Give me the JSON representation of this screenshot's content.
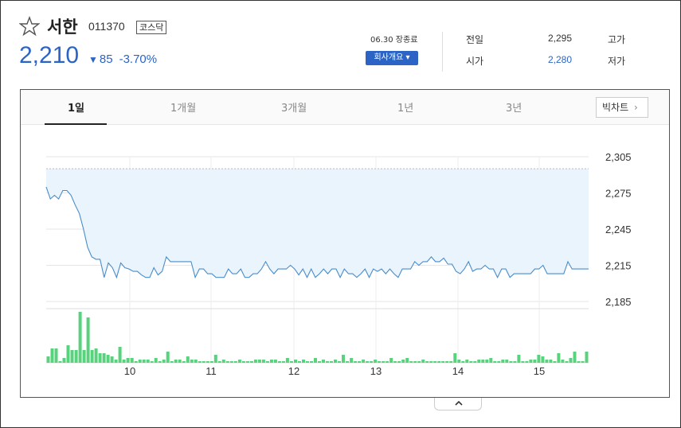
{
  "stock": {
    "name": "서한",
    "code": "011370",
    "market": "코스닥",
    "price": "2,210",
    "change": "85",
    "change_pct": "-3.70%",
    "close_info": "06.30 장종료",
    "company_button": "회사개요"
  },
  "stats": {
    "prev_label": "전일",
    "prev_value": "2,295",
    "high_label": "고가",
    "open_label": "시가",
    "open_value": "2,280",
    "low_label": "저가"
  },
  "tabs": [
    "1일",
    "1개월",
    "3개월",
    "1년",
    "3년"
  ],
  "active_tab": "1일",
  "big_chart_label": "빅차트",
  "colors": {
    "price_line": "#4a8cc9",
    "area_fill": "#eaf4fd",
    "volume_bar": "#59d27d",
    "down": "#2c64c6"
  },
  "chart_data": {
    "type": "line",
    "y_ticks": [
      "2,305",
      "2,275",
      "2,245",
      "2,215",
      "2,185"
    ],
    "ylim": [
      2185,
      2305
    ],
    "x_ticks": [
      "10",
      "11",
      "12",
      "13",
      "14",
      "15"
    ],
    "prev_close": 2295,
    "price_series": [
      2280,
      2270,
      2273,
      2270,
      2277,
      2277,
      2273,
      2265,
      2258,
      2245,
      2230,
      2222,
      2220,
      2220,
      2205,
      2217,
      2213,
      2205,
      2217,
      2213,
      2212,
      2210,
      2210,
      2207,
      2205,
      2205,
      2213,
      2207,
      2210,
      2222,
      2218,
      2218,
      2218,
      2218,
      2218,
      2218,
      2205,
      2212,
      2212,
      2208,
      2208,
      2205,
      2205,
      2205,
      2212,
      2208,
      2208,
      2212,
      2205,
      2205,
      2208,
      2208,
      2212,
      2218,
      2212,
      2208,
      2212,
      2212,
      2212,
      2215,
      2212,
      2207,
      2212,
      2205,
      2212,
      2205,
      2208,
      2212,
      2208,
      2212,
      2212,
      2205,
      2212,
      2208,
      2208,
      2205,
      2208,
      2212,
      2205,
      2212,
      2210,
      2212,
      2208,
      2212,
      2208,
      2205,
      2212,
      2212,
      2212,
      2218,
      2215,
      2218,
      2218,
      2222,
      2218,
      2218,
      2221,
      2216,
      2216,
      2210,
      2208,
      2212,
      2218,
      2210,
      2212,
      2212,
      2215,
      2212,
      2212,
      2205,
      2212,
      2212,
      2205,
      2208,
      2208,
      2208,
      2208,
      2208,
      2212,
      2212,
      2215,
      2208,
      2208,
      2208,
      2208,
      2208,
      2218,
      2212,
      2212,
      2212,
      2212,
      2212
    ],
    "volume_series": [
      8,
      18,
      18,
      2,
      6,
      22,
      16,
      16,
      64,
      16,
      57,
      16,
      18,
      12,
      12,
      10,
      8,
      4,
      20,
      4,
      6,
      6,
      2,
      4,
      4,
      4,
      2,
      6,
      2,
      4,
      14,
      2,
      4,
      4,
      2,
      8,
      4,
      4,
      2,
      2,
      2,
      2,
      10,
      2,
      4,
      2,
      2,
      2,
      4,
      2,
      2,
      2,
      4,
      4,
      4,
      2,
      4,
      4,
      2,
      2,
      6,
      2,
      4,
      2,
      4,
      2,
      2,
      6,
      2,
      4,
      2,
      2,
      4,
      2,
      10,
      2,
      6,
      2,
      2,
      4,
      2,
      2,
      4,
      2,
      2,
      2,
      6,
      2,
      2,
      4,
      6,
      2,
      2,
      2,
      4,
      2,
      2,
      2,
      2,
      2,
      2,
      2,
      12,
      4,
      2,
      4,
      2,
      2,
      4,
      4,
      4,
      6,
      2,
      2,
      4,
      4,
      2,
      2,
      10,
      2,
      2,
      4,
      4,
      10,
      8,
      4,
      4,
      2,
      12,
      4,
      2,
      6,
      14,
      2,
      2,
      14
    ]
  }
}
